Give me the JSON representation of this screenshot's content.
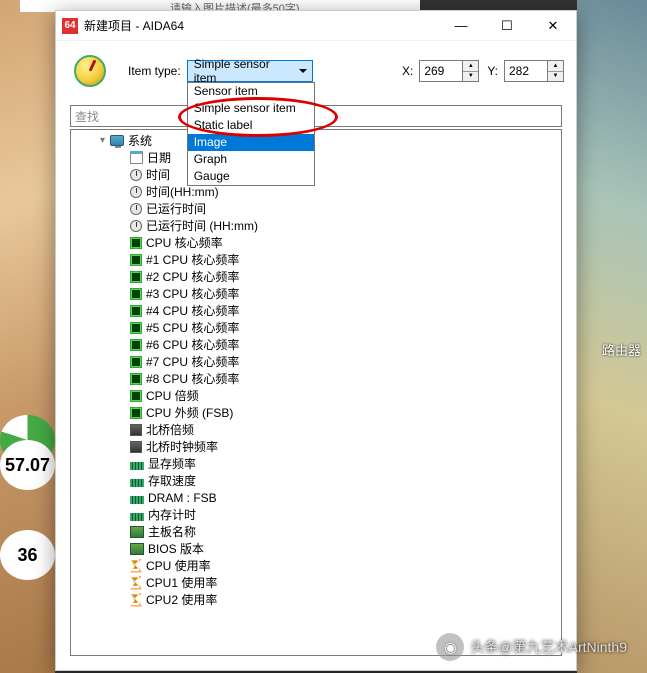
{
  "bg": {
    "top_hint": "请输入图片描述(最多50字)",
    "gauge1": "57.07",
    "gauge2": "36",
    "router": "路由器"
  },
  "window": {
    "app_badge": "64",
    "title": "新建项目 - AIDA64"
  },
  "toolbar": {
    "item_type_label": "Item type:",
    "combo_value": "Simple sensor item",
    "options": [
      "Sensor item",
      "Simple sensor item",
      "Static label",
      "Image",
      "Graph",
      "Gauge"
    ],
    "selected_index": 3,
    "x_label": "X:",
    "x_value": "269",
    "y_label": "Y:",
    "y_value": "282"
  },
  "search_placeholder": "查找",
  "tree": [
    {
      "lvl": 1,
      "icon": "monitor",
      "label": "系统",
      "exp": "▾"
    },
    {
      "lvl": 2,
      "icon": "cal",
      "label": "日期"
    },
    {
      "lvl": 2,
      "icon": "clock",
      "label": "时间"
    },
    {
      "lvl": 2,
      "icon": "clock",
      "label": "时间(HH:mm)"
    },
    {
      "lvl": 2,
      "icon": "clock",
      "label": "已运行时间"
    },
    {
      "lvl": 2,
      "icon": "clock",
      "label": "已运行时间 (HH:mm)"
    },
    {
      "lvl": 2,
      "icon": "cpu",
      "label": "CPU 核心频率"
    },
    {
      "lvl": 2,
      "icon": "cpu",
      "label": "#1 CPU 核心频率"
    },
    {
      "lvl": 2,
      "icon": "cpu",
      "label": "#2 CPU 核心频率"
    },
    {
      "lvl": 2,
      "icon": "cpu",
      "label": "#3 CPU 核心频率"
    },
    {
      "lvl": 2,
      "icon": "cpu",
      "label": "#4 CPU 核心频率"
    },
    {
      "lvl": 2,
      "icon": "cpu",
      "label": "#5 CPU 核心频率"
    },
    {
      "lvl": 2,
      "icon": "cpu",
      "label": "#6 CPU 核心频率"
    },
    {
      "lvl": 2,
      "icon": "cpu",
      "label": "#7 CPU 核心频率"
    },
    {
      "lvl": 2,
      "icon": "cpu",
      "label": "#8 CPU 核心频率"
    },
    {
      "lvl": 2,
      "icon": "cpu",
      "label": "CPU 倍频"
    },
    {
      "lvl": 2,
      "icon": "cpu",
      "label": "CPU 外频 (FSB)"
    },
    {
      "lvl": 2,
      "icon": "chip",
      "label": "北桥倍频"
    },
    {
      "lvl": 2,
      "icon": "chip",
      "label": "北桥时钟频率"
    },
    {
      "lvl": 2,
      "icon": "mem",
      "label": "显存频率"
    },
    {
      "lvl": 2,
      "icon": "mem",
      "label": "存取速度"
    },
    {
      "lvl": 2,
      "icon": "mem",
      "label": "DRAM : FSB"
    },
    {
      "lvl": 2,
      "icon": "mem",
      "label": "内存计时"
    },
    {
      "lvl": 2,
      "icon": "mb",
      "label": "主板名称"
    },
    {
      "lvl": 2,
      "icon": "mb",
      "label": "BIOS 版本"
    },
    {
      "lvl": 2,
      "icon": "hg",
      "label": "CPU 使用率"
    },
    {
      "lvl": 2,
      "icon": "hg",
      "label": "CPU1 使用率"
    },
    {
      "lvl": 2,
      "icon": "hg",
      "label": "CPU2 使用率"
    }
  ],
  "watermark": "头条@第九艺术ArtNinth9"
}
